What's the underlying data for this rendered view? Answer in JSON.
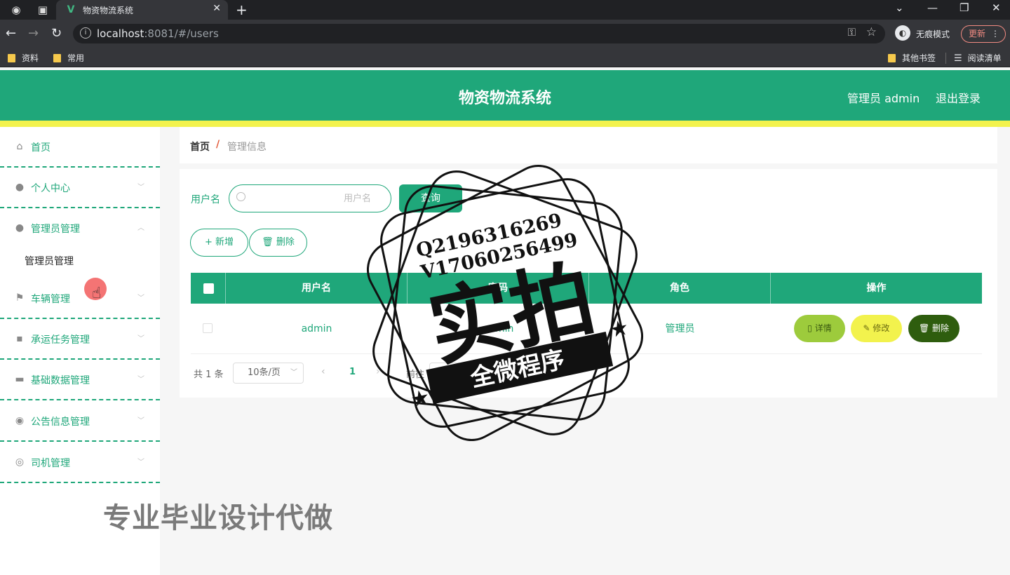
{
  "browser": {
    "tab_title": "物资物流系统",
    "url_host": "localhost",
    "url_path": ":8081/#/users",
    "incognito_label": "无痕模式",
    "update_label": "更新",
    "bookmarks": [
      "资料",
      "常用"
    ],
    "bookmarks_right": [
      "其他书签",
      "阅读清单"
    ]
  },
  "header": {
    "title": "物资物流系统",
    "user_label": "管理员 admin",
    "logout_label": "退出登录",
    "accent_color": "#1fa77a",
    "stripe_color": "#f2f24d"
  },
  "sidebar": {
    "items": [
      {
        "label": "首页",
        "icon": "home-icon"
      },
      {
        "label": "个人中心",
        "icon": "user-icon"
      },
      {
        "label": "管理员管理",
        "icon": "user-icon"
      },
      {
        "label": "车辆管理",
        "icon": "flag-icon"
      },
      {
        "label": "承运任务管理",
        "icon": "chat-icon"
      },
      {
        "label": "基础数据管理",
        "icon": "briefcase-icon"
      },
      {
        "label": "公告信息管理",
        "icon": "bulb-icon"
      },
      {
        "label": "司机管理",
        "icon": "gauge-icon"
      }
    ],
    "submenu_label": "管理员管理"
  },
  "breadcrumb": {
    "home": "首页",
    "separator": "/",
    "current": "管理信息"
  },
  "search": {
    "label": "用户名",
    "placeholder": "用户名",
    "query_label": "查询"
  },
  "actions": {
    "add_label": "+ 新增",
    "delete_label": "删除"
  },
  "table": {
    "columns": [
      "用户名",
      "密码",
      "角色",
      "操作"
    ],
    "rows": [
      {
        "username": "admin",
        "password": "admin",
        "role": "管理员"
      }
    ],
    "op_detail": "详情",
    "op_edit": "修改",
    "op_delete": "删除"
  },
  "pagination": {
    "total": "共 1 条",
    "page_size": "10条/页",
    "current_page": "1",
    "goto_label": "前往",
    "goto_value": "1"
  },
  "watermark": {
    "line1": "Q2196316269",
    "line2": "V17060256499",
    "big": "实拍",
    "banner": "全微程序",
    "caption": "专业毕业设计代做"
  }
}
